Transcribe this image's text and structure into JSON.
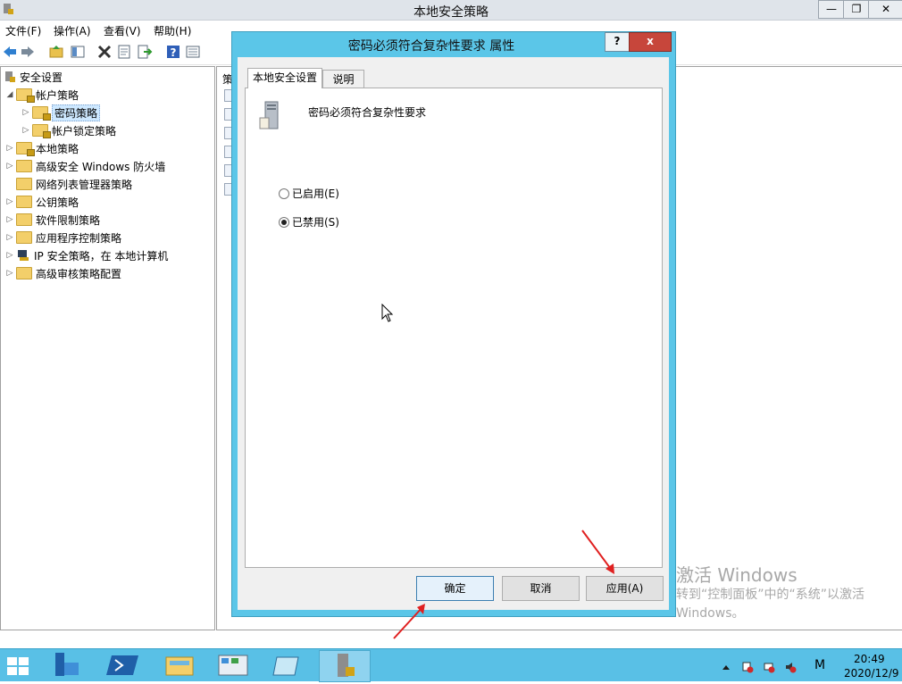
{
  "window": {
    "title": "本地安全策略"
  },
  "menu": [
    "文件(F)",
    "操作(A)",
    "查看(V)",
    "帮助(H)"
  ],
  "tree": {
    "root": "安全设置",
    "items": [
      {
        "label": "帐户策略",
        "level": 1,
        "expanded": true
      },
      {
        "label": "密码策略",
        "level": 2,
        "selected": true
      },
      {
        "label": "帐户锁定策略",
        "level": 2
      },
      {
        "label": "本地策略",
        "level": 1
      },
      {
        "label": "高级安全 Windows 防火墙",
        "level": 1
      },
      {
        "label": "网络列表管理器策略",
        "level": 1
      },
      {
        "label": "公钥策略",
        "level": 1
      },
      {
        "label": "软件限制策略",
        "level": 1
      },
      {
        "label": "应用程序控制策略",
        "level": 1
      },
      {
        "label": "IP 安全策略，在 本地计算机",
        "level": 1
      },
      {
        "label": "高级审核策略配置",
        "level": 1
      }
    ]
  },
  "list_header_stub": "策",
  "dialog": {
    "title": "密码必须符合复杂性要求 属性",
    "help": "?",
    "close": "x",
    "tabs": [
      "本地安全设置",
      "说明"
    ],
    "policy_name": "密码必须符合复杂性要求",
    "options": [
      {
        "label": "已启用(E)",
        "checked": false
      },
      {
        "label": "已禁用(S)",
        "checked": true
      }
    ],
    "buttons": {
      "ok": "确定",
      "cancel": "取消",
      "apply": "应用(A)"
    }
  },
  "watermark": {
    "line1": "激活 Windows",
    "line2": "转到“控制面板”中的“系统”以激活",
    "line3": "Windows。"
  },
  "clock": {
    "time": "20:49",
    "date": "2020/12/9"
  },
  "colors": {
    "dialog_frame": "#5bc6e8",
    "taskbar": "#59c0e6",
    "close_button": "#c7463b",
    "annotation_arrow": "#e02020"
  }
}
